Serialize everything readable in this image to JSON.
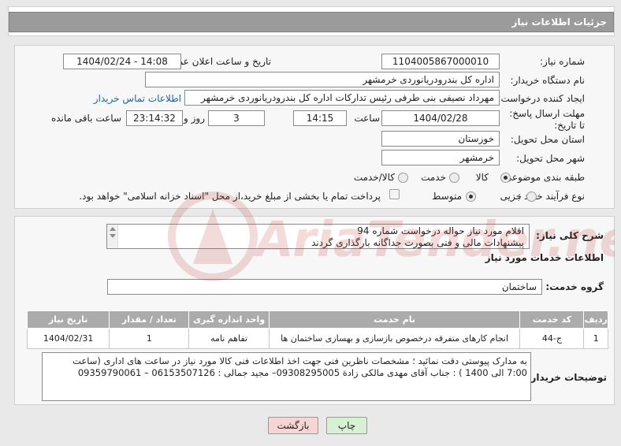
{
  "page_title": "جزئیات اطلاعات نیاز",
  "fields": {
    "need_number_label": "شماره نیاز:",
    "need_number": "1104005867000010",
    "announce_label": "تاریخ و ساعت اعلان عمومی:",
    "announce_value": "1404/02/24 - 14:08",
    "buyer_label": "نام دستگاه خریدار:",
    "buyer_value": "اداره کل بندرودریانوردی خرمشهر",
    "creator_label": "ایجاد کننده درخواست:",
    "creator_value": "مهرداد  نصیفی بنی طرفی رئیس تدارکات اداره کل بندرودریانوردی خرمشهر",
    "contact_link": "اطلاعات تماس خریدار",
    "deadline_label": "مهلت ارسال پاسخ: تا تاریخ:",
    "deadline_date": "1404/02/28",
    "time_label": "ساعت",
    "deadline_time": "14:15",
    "days_value": "3",
    "days_label": "روز و",
    "remaining_time": "23:14:32",
    "remaining_label": "ساعت باقی مانده",
    "province_label": "استان محل تحویل:",
    "province_value": "خوزستان",
    "city_label": "شهر محل تحویل:",
    "city_value": "خرمشهر",
    "category_label": "طبقه بندی موضوعی:",
    "category_options": [
      "کالا",
      "خدمت",
      "کالا/خدمت"
    ],
    "process_label": "نوع فرآیند خرید :",
    "process_options": [
      "جزیی",
      "متوسط"
    ],
    "payment_text": "پرداخت تمام یا بخشی از مبلغ خرید،از محل \"اسناد خزانه اسلامی\" خواهد بود."
  },
  "summary": {
    "label": "شرح کلی نیاز:",
    "line1": "اقلام مورد نیاز حواله درخواست شماره 94",
    "line2": "پیشنهادات مالی و فنی بصورت جداگانه بارگذاری گردند"
  },
  "services": {
    "section_title": "اطلاعات خدمات مورد نیاز",
    "group_label": "گروه خدمت:",
    "group_value": "ساختمان",
    "table": {
      "headers": [
        "ردیف",
        "کد خدمت",
        "نام خدمت",
        "واحد اندازه گیری",
        "تعداد / مقدار",
        "تاریخ نیاز"
      ],
      "rows": [
        [
          "1",
          "ج-44",
          "انجام کارهای متفرقه درخصوص بازسازی و بهسازی ساختمان ها",
          "تفاهم نامه",
          "1",
          "1404/02/31"
        ]
      ]
    }
  },
  "buyer_notes": {
    "label": "توضیحات خریدار:",
    "line1": "به مدارک پیوستی دقت نمائید ؛ مشخصات ناظرین فنی جهت اخذ اطلاعات فنی کالا مورد نیاز در ساعت های اداری (ساعت",
    "line2": "7:00 الی 1400 ) : جناب آقای مهدی مالکی زادة 09308295005– مجید جمالی : 06153507126 – 09359790061"
  },
  "buttons": {
    "print": "چاپ",
    "back": "بازگشت"
  },
  "watermark": "AriaTender.net",
  "colors": {
    "header_bg": "#9b9b9b",
    "link": "#1d64a3",
    "back_button": "#f6d5d5",
    "print_button": "#d8f0d4",
    "watermark": "#c23b3b"
  }
}
